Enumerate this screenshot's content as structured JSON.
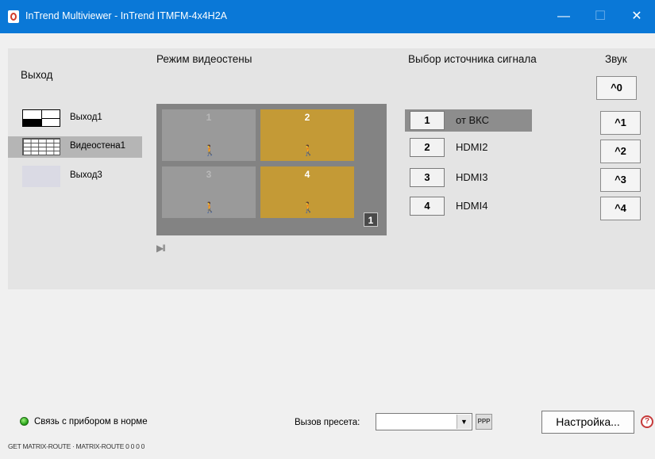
{
  "window": {
    "title": "InTrend Multiviewer - InTrend ITMFM-4x4H2A",
    "min_symbol": "—",
    "max_symbol": "☐",
    "close_symbol": "✕"
  },
  "outputs": {
    "label": "Выход",
    "items": [
      {
        "label": "Выход1",
        "icon": "split-layout-icon",
        "selected": false
      },
      {
        "label": "Видеостена1",
        "icon": "videowall-grid-icon",
        "selected": true
      },
      {
        "label": "Выход3",
        "icon": "blank-layout-icon",
        "selected": false
      }
    ]
  },
  "wall": {
    "label": "Режим видеостены",
    "cells": [
      {
        "num": "1",
        "state": "inactive"
      },
      {
        "num": "2",
        "state": "active"
      },
      {
        "num": "3",
        "state": "inactive"
      },
      {
        "num": "4",
        "state": "active"
      }
    ],
    "figure_symbol": "🚶",
    "badge": "1",
    "play_pause_symbol": "▶II"
  },
  "sources": {
    "label": "Выбор источника сигнала",
    "items": [
      {
        "num": "1",
        "name": "от ВКС",
        "selected": true
      },
      {
        "num": "2",
        "name": "HDMI2",
        "selected": false
      },
      {
        "num": "3",
        "name": "HDMI3",
        "selected": false
      },
      {
        "num": "4",
        "name": "HDMI4",
        "selected": false
      }
    ]
  },
  "sound": {
    "label": "Звук",
    "buttons": [
      "^0",
      "^1",
      "^2",
      "^3",
      "^4"
    ]
  },
  "footer": {
    "status": "Связь с прибором в норме",
    "preset_label": "Вызов пресета:",
    "preset_value": "",
    "dropdown_symbol": "▼",
    "ppp_label": "PPP",
    "settings_label": "Настройка...",
    "help_symbol": "?",
    "command": "GET MATRIX-ROUTE · MATRIX-ROUTE 0 0 0 0"
  },
  "colors": {
    "titlebar": "#0a78d7",
    "active_cell": "#c49a36",
    "inactive_cell": "#9a9a9a",
    "status_led": "#2fb81d"
  }
}
